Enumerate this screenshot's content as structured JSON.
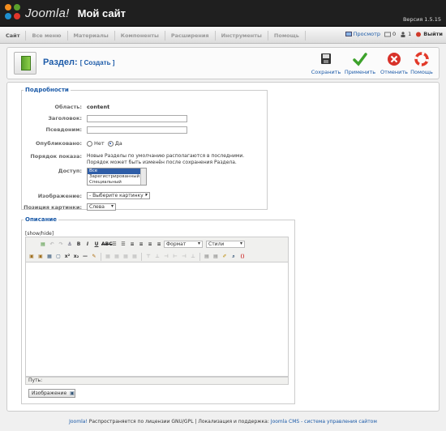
{
  "header": {
    "logo_text": "Joomla!",
    "site_name": "Мой сайт",
    "version": "Версия 1.5.15"
  },
  "menu": {
    "items": [
      "Сайт",
      "Все меню",
      "Материалы",
      "Компоненты",
      "Расширения",
      "Инструменты",
      "Помощь"
    ],
    "preview": "Просмотр",
    "messages": "0",
    "users": "1",
    "logout": "Выйти"
  },
  "toolbar": {
    "title": "Раздел:",
    "subtitle": "[ Создать ]",
    "save": "Сохранить",
    "apply": "Применить",
    "cancel": "Отменить",
    "help": "Помощь"
  },
  "details": {
    "legend": "Подробности",
    "scope_label": "Область:",
    "scope_value": "content",
    "title_label": "Заголовок:",
    "title_value": "",
    "alias_label": "Псевдоним:",
    "alias_value": "",
    "published_label": "Опубликовано:",
    "published_no": "Нет",
    "published_yes": "Да",
    "order_label": "Порядок показа:",
    "order_text": "Новые Разделы по умолчанию располагаются в последними. Порядок может быть изменён после сохранения Раздела.",
    "access_label": "Доступ:",
    "access_options": [
      "Все",
      "Зарегистрированный",
      "Специальный"
    ],
    "image_label": "Изображение:",
    "image_value": "- Выберите картинку -",
    "image_pos_label": "Позиция картинки:",
    "image_pos_value": "Слева"
  },
  "description": {
    "legend": "Описание",
    "showhide": "[show/hide]",
    "format": "Формат",
    "styles": "Стили",
    "path_label": "Путь:",
    "image_button": "Изображение"
  },
  "footer": {
    "joomla": "Joomla!",
    "license": " Распространяется по лицензии GNU/GPL | Локализация и поддержка: ",
    "link": "Joomla CMS - система управления сайтом"
  }
}
